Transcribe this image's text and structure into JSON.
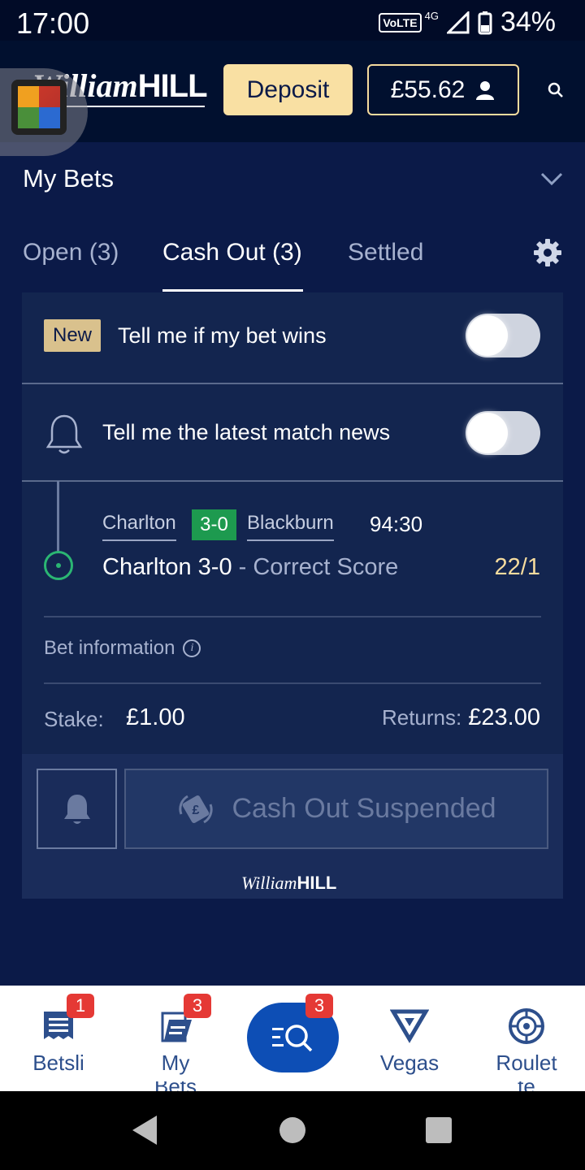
{
  "status_bar": {
    "time": "17:00",
    "volte": "VoLTE",
    "network": "4G",
    "battery": "34%"
  },
  "header": {
    "logo_script": "William",
    "logo_bold": "HILL",
    "deposit_label": "Deposit",
    "balance": "£55.62"
  },
  "my_bets": {
    "title": "My Bets"
  },
  "tabs": [
    {
      "label": "Open (3)",
      "active": false
    },
    {
      "label": "Cash Out (3)",
      "active": true
    },
    {
      "label": "Settled",
      "active": false
    }
  ],
  "notifications": {
    "new_badge": "New",
    "bet_wins_label": "Tell me if my bet wins",
    "bet_wins_on": false,
    "match_news_label": "Tell me the latest match news",
    "match_news_on": false
  },
  "bet": {
    "home_team": "Charlton",
    "score": "3-0",
    "away_team": "Blackburn",
    "match_clock": "94:30",
    "selection": "Charlton 3-0",
    "market": " - Correct Score",
    "odds": "22/1",
    "bet_info_label": "Bet information",
    "stake_label": "Stake:",
    "stake_value": "£1.00",
    "returns_label": "Returns:",
    "returns_value": "£23.00",
    "cashout_label": "Cash Out Suspended"
  },
  "footer_logo": {
    "script": "William",
    "bold": "HILL"
  },
  "bottom_nav": [
    {
      "label": "Betsli",
      "badge": "1",
      "icon": "betslip-icon"
    },
    {
      "label": "My",
      "label_line2": "Bets",
      "badge": "3",
      "icon": "mybets-icon"
    },
    {
      "label": "",
      "badge": "3",
      "icon": "search-menu-icon"
    },
    {
      "label": "Vegas",
      "icon": "vegas-icon"
    },
    {
      "label": "Roulet",
      "label_line2": "te",
      "icon": "roulette-icon"
    }
  ],
  "colors": {
    "background": "#0b1a48",
    "accent_gold": "#f6dc9e",
    "live_green": "#1d9a4f",
    "nav_blue": "#0d4eb5",
    "badge_red": "#e53935"
  }
}
